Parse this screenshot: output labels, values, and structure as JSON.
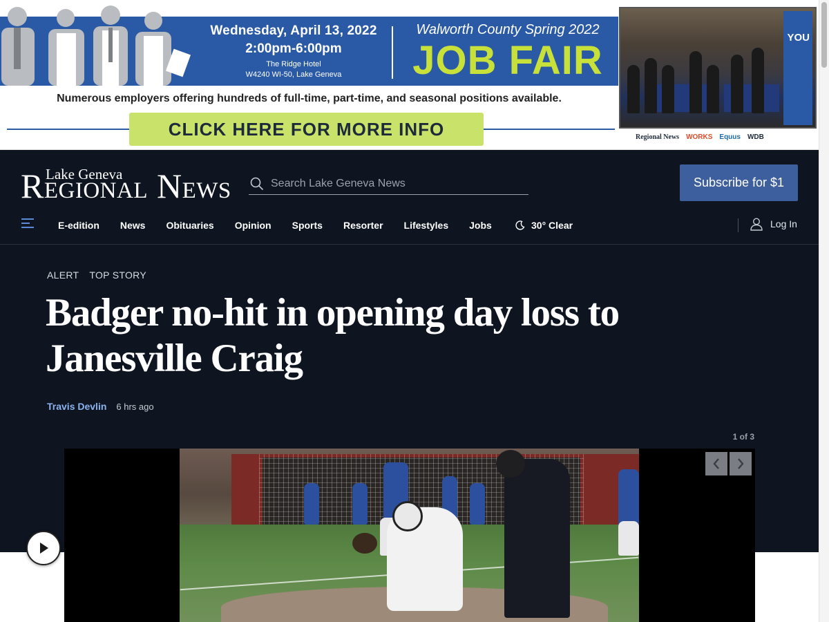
{
  "ad": {
    "date": "Wednesday, April 13, 2022",
    "time": "2:00pm-6:00pm",
    "venue": "The Ridge Hotel",
    "address": "W4240 WI-50, Lake Geneva",
    "event_series": "Walworth County Spring 2022",
    "event_title": "JOB FAIR",
    "tagline": "Numerous employers offering hundreds of full-time, part-time, and seasonal positions available.",
    "cta": "CLICK HERE FOR MORE INFO",
    "photo_sign": "YOU",
    "sponsors": [
      "Regional News",
      "WORKS",
      "Equus",
      "WDB"
    ],
    "colors": {
      "blue": "#2a5aa6",
      "accent_green": "#c8e03a",
      "cta_bg": "#c9e26a"
    }
  },
  "header": {
    "logo_top": "Lake Geneva",
    "logo_bottom_r": "R",
    "logo_bottom_rest1": "EGIONAL",
    "logo_bottom_n": " N",
    "logo_bottom_rest2": "EWS",
    "search_placeholder": "Search Lake Geneva News",
    "subscribe_label": "Subscribe for $1",
    "colors": {
      "background": "#0e1520",
      "subscribe": "#3e5f9e"
    }
  },
  "nav": {
    "items": [
      "E-edition",
      "News",
      "Obituaries",
      "Opinion",
      "Sports",
      "Resorter",
      "Lifestyles",
      "Jobs"
    ],
    "weather": "30° Clear",
    "login": "Log In"
  },
  "article": {
    "tags": [
      "ALERT",
      "TOP STORY"
    ],
    "headline": "Badger no-hit in opening day loss to Janesville Craig",
    "author": "Travis Devlin",
    "time": "6 hrs ago",
    "gallery_counter": "1 of 3",
    "author_color": "#8cb2f0"
  },
  "icons": {
    "search": "search-icon",
    "menu": "hamburger-menu-icon",
    "weather": "moon-icon",
    "user": "user-icon",
    "prev": "chevron-left-icon",
    "next": "chevron-right-icon",
    "play": "play-icon"
  }
}
